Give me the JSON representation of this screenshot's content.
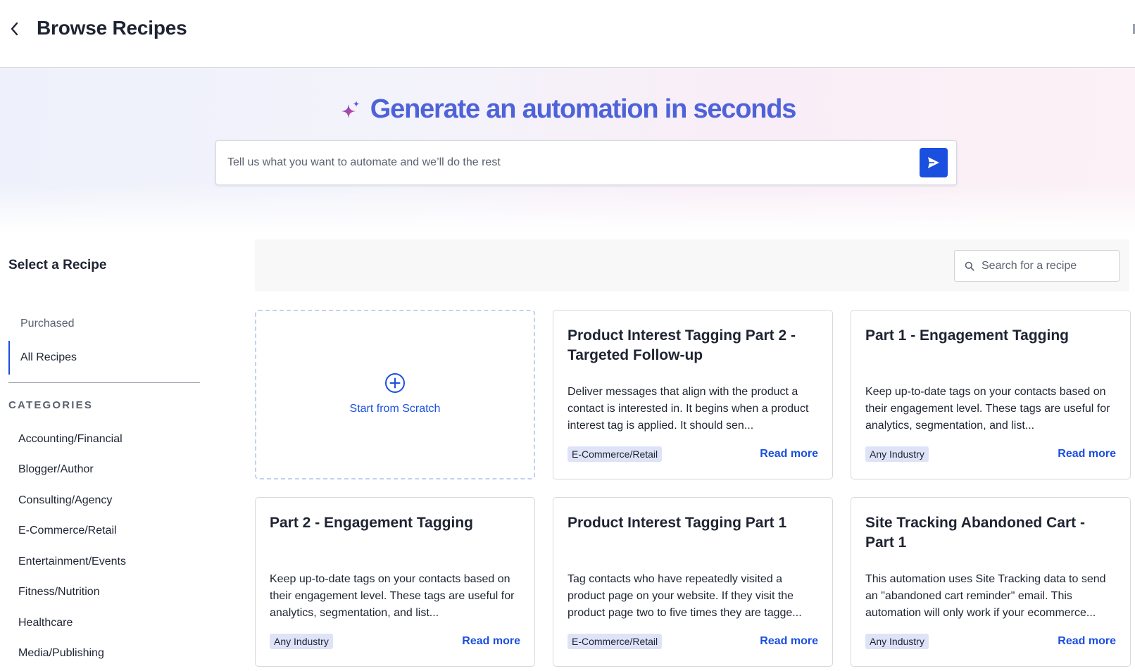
{
  "header": {
    "title": "Browse Recipes",
    "back_icon": "chevron-left-icon"
  },
  "hero": {
    "title": "Generate an automation in seconds",
    "sparkle_icon": "sparkle-icon",
    "prompt_placeholder": "Tell us what you want to automate and we’ll do the rest",
    "send_icon": "send-icon"
  },
  "sidebar": {
    "title": "Select a Recipe",
    "nav": [
      {
        "label": "Purchased",
        "active": false
      },
      {
        "label": "All Recipes",
        "active": true
      }
    ],
    "categories_label": "CATEGORIES",
    "categories": [
      "Accounting/Financial",
      "Blogger/Author",
      "Consulting/Agency",
      "E-Commerce/Retail",
      "Entertainment/Events",
      "Fitness/Nutrition",
      "Healthcare",
      "Media/Publishing"
    ]
  },
  "search": {
    "placeholder": "Search for a recipe"
  },
  "scratch": {
    "label": "Start from Scratch"
  },
  "cards": [
    {
      "title": "Product Interest Tagging Part 2 - Targeted Follow-up",
      "description": "Deliver messages that align with the product a contact is interested in. It begins when a product interest tag is applied. It should sen...",
      "badge": "E-Commerce/Retail",
      "link": "Read more"
    },
    {
      "title": "Part 1 - Engagement Tagging",
      "description": "Keep up-to-date tags on your contacts based on their engagement level. These tags are useful for analytics, segmentation, and list...",
      "badge": "Any Industry",
      "link": "Read more"
    },
    {
      "title": "Part 2 - Engagement Tagging",
      "description": "Keep up-to-date tags on your contacts based on their engagement level. These tags are useful for analytics, segmentation, and list...",
      "badge": "Any Industry",
      "link": "Read more"
    },
    {
      "title": "Product Interest Tagging Part 1",
      "description": "Tag contacts who have repeatedly visited a product page on your website. If they visit the product page two to five times they are tagge...",
      "badge": "E-Commerce/Retail",
      "link": "Read more"
    },
    {
      "title": "Site Tracking Abandoned Cart - Part 1",
      "description": "This automation uses Site Tracking data to send an \"abandoned cart reminder\" email. This automation will only work if your ecommerce...",
      "badge": "Any Industry",
      "link": "Read more"
    }
  ],
  "colors": {
    "accent": "#1a4fe0",
    "hero_title": "#4e63d9",
    "badge_bg": "#dfe3f7"
  }
}
